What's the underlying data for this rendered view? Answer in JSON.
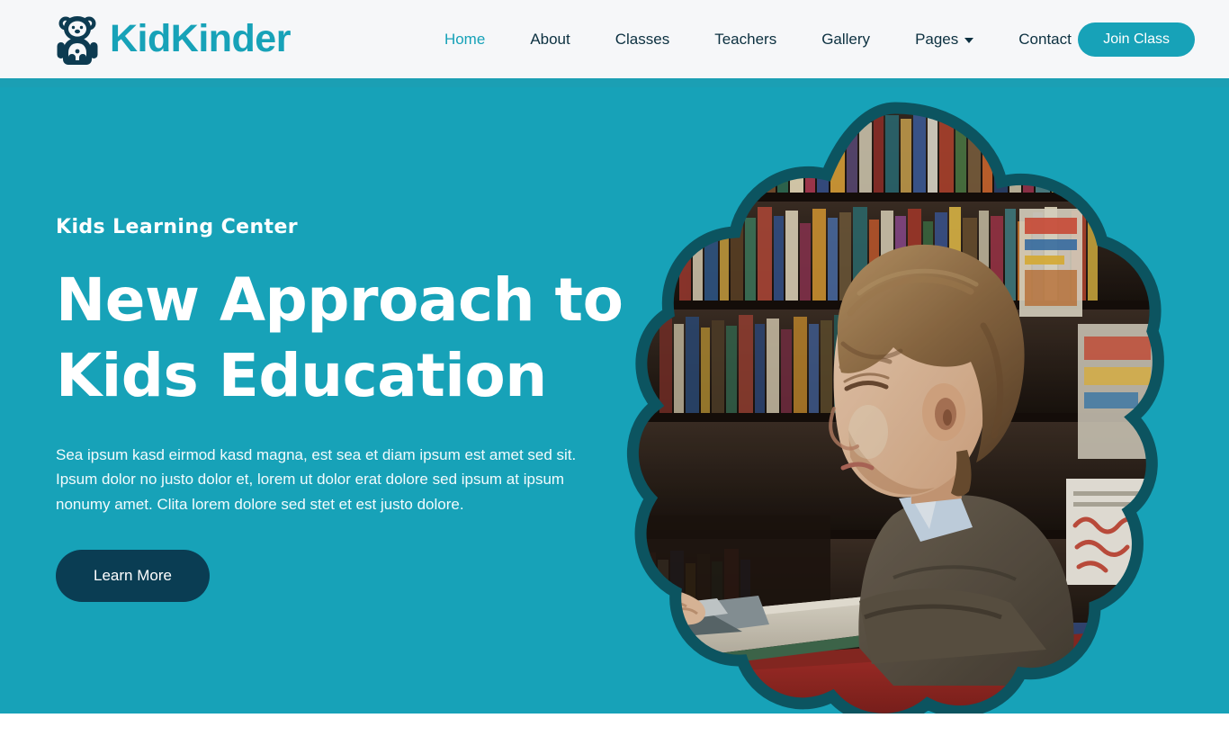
{
  "brand": {
    "name": "KidKinder",
    "icon": "teddy-bear-icon",
    "color": "#17a2b8"
  },
  "nav": {
    "items": [
      {
        "label": "Home",
        "active": true,
        "dropdown": false
      },
      {
        "label": "About",
        "active": false,
        "dropdown": false
      },
      {
        "label": "Classes",
        "active": false,
        "dropdown": false
      },
      {
        "label": "Teachers",
        "active": false,
        "dropdown": false
      },
      {
        "label": "Gallery",
        "active": false,
        "dropdown": false
      },
      {
        "label": "Pages",
        "active": false,
        "dropdown": true
      },
      {
        "label": "Contact",
        "active": false,
        "dropdown": false
      }
    ],
    "cta_label": "Join Class"
  },
  "hero": {
    "eyebrow": "Kids Learning Center",
    "title_line1": "New Approach to",
    "title_line2": "Kids Education",
    "description": "Sea ipsum kasd eirmod kasd magna, est sea et diam ipsum est amet sed sit. Ipsum dolor no justo dolor et, lorem ut dolor erat dolore sed ipsum at ipsum nonumy amet. Clita lorem dolore sed stet et est justo dolore.",
    "cta_label": "Learn More",
    "image_alt": "boy-reading-book-in-library",
    "background_color": "#17a2b8",
    "cloud_border_color": "#0c5460"
  }
}
